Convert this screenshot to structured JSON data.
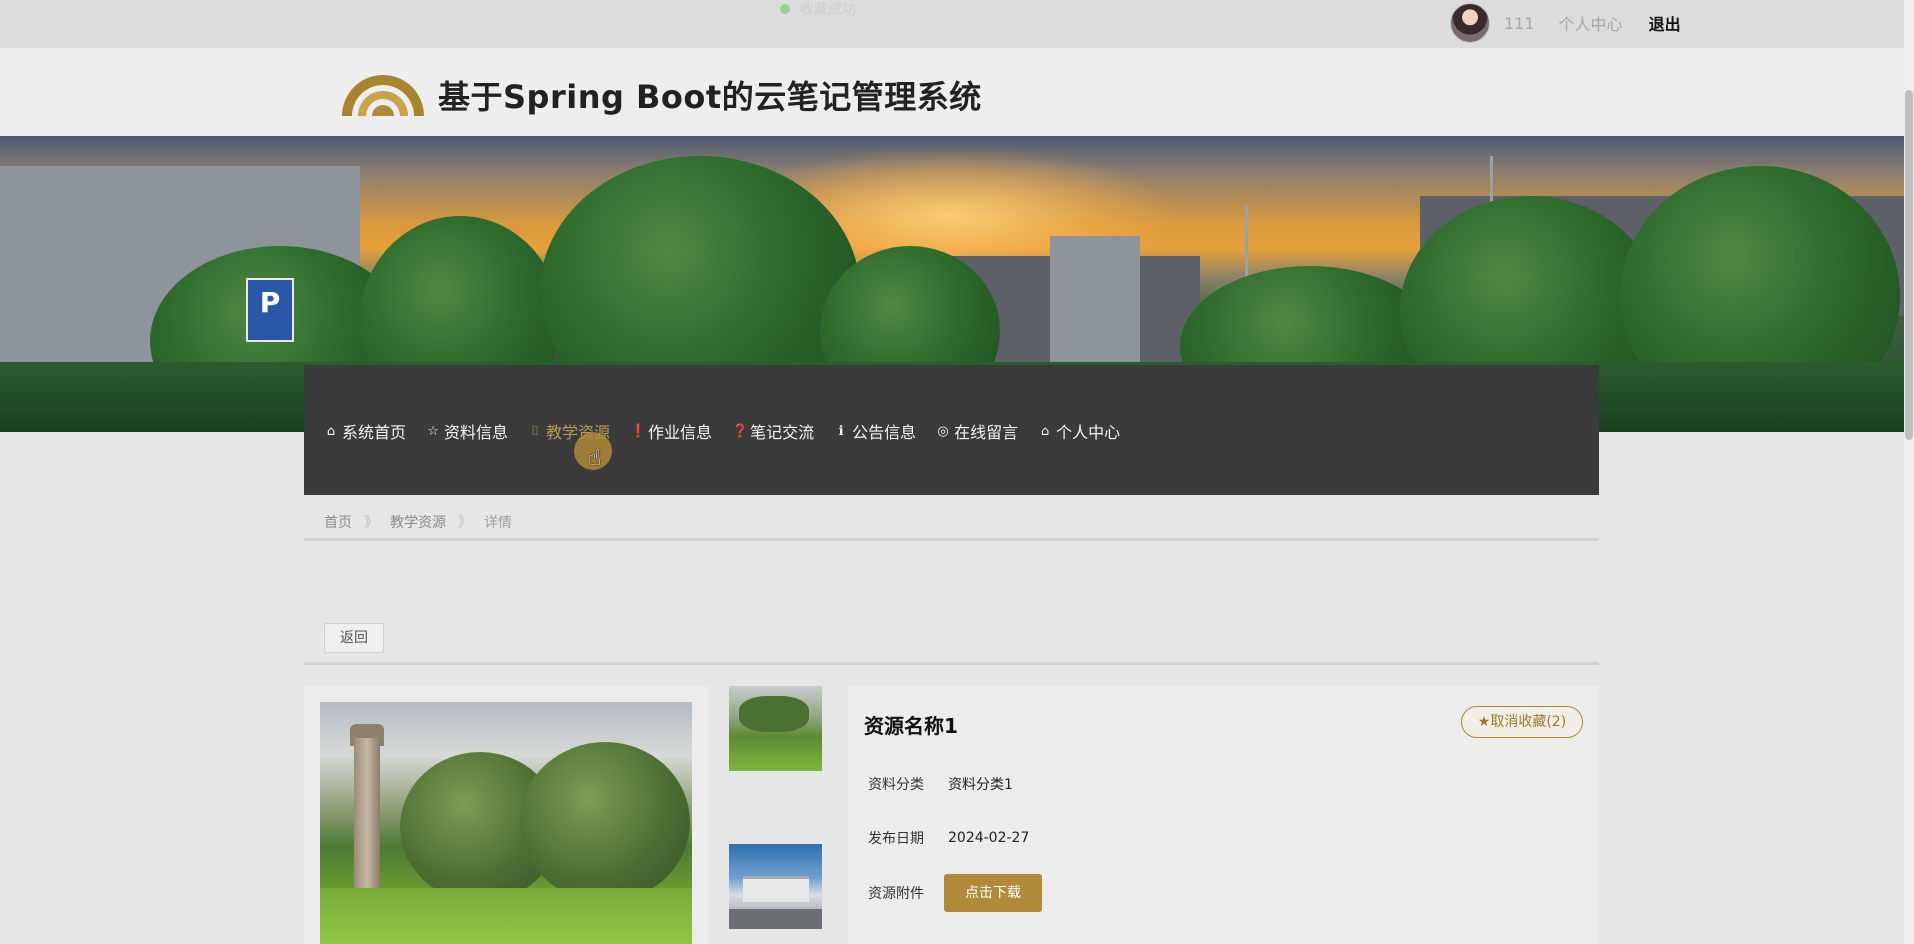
{
  "topbar": {
    "fav_status": "收藏成功",
    "username": "111",
    "user_center": "个人中心",
    "logout": "退出"
  },
  "header": {
    "site_title": "基于Spring Boot的云笔记管理系统"
  },
  "banner": {
    "parking_sign": "P"
  },
  "nav": {
    "items": [
      {
        "icon": "home-icon",
        "label": "系统首页"
      },
      {
        "icon": "star-icon",
        "label": "资料信息"
      },
      {
        "icon": "bag-icon",
        "label": "教学资源"
      },
      {
        "icon": "exclamation-icon",
        "label": "作业信息"
      },
      {
        "icon": "question-icon",
        "label": "笔记交流"
      },
      {
        "icon": "info-icon",
        "label": "公告信息"
      },
      {
        "icon": "chat-icon",
        "label": "在线留言"
      },
      {
        "icon": "home-icon",
        "label": "个人中心"
      }
    ],
    "active_index": 2
  },
  "breadcrumb": {
    "home": "首页",
    "section": "教学资源",
    "current": "详情",
    "separator": "》"
  },
  "back_button": "返回",
  "detail": {
    "name": "资源名称1",
    "unfavorite_button": "★取消收藏(2)",
    "category_label": "资料分类",
    "category_value": "资料分类1",
    "date_label": "发布日期",
    "date_value": "2024-02-27",
    "attachment_label": "资源附件",
    "download_button": "点击下载"
  },
  "colors": {
    "accent": "#b08a38",
    "nav_bg": "#3b3b3b",
    "page_bg": "#e6e6e6"
  }
}
